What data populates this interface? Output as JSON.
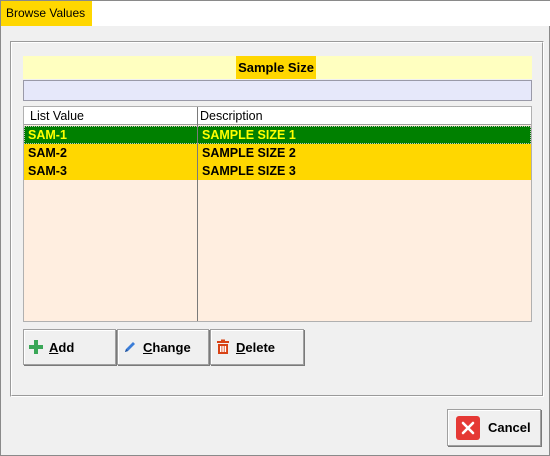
{
  "window": {
    "title": "Browse Values"
  },
  "header": {
    "title": "Sample Size"
  },
  "filter": {
    "value": ""
  },
  "table": {
    "columns": [
      "List Value",
      "Description"
    ],
    "rows": [
      {
        "value": "SAM-1",
        "description": "SAMPLE SIZE 1",
        "selected": true
      },
      {
        "value": "SAM-2",
        "description": "SAMPLE SIZE 2",
        "selected": false
      },
      {
        "value": "SAM-3",
        "description": "SAMPLE SIZE 3",
        "selected": false
      }
    ]
  },
  "actions": {
    "add": {
      "first": "A",
      "rest": "dd",
      "icon": "plus-icon"
    },
    "change": {
      "first": "C",
      "rest": "hange",
      "icon": "pencil-icon"
    },
    "delete": {
      "first": "D",
      "rest": "elete",
      "icon": "trash-icon"
    }
  },
  "footer": {
    "cancel_label": "Cancel",
    "cancel_icon": "close-icon"
  },
  "colors": {
    "accent": "#ffd700",
    "selected_row": "#008000",
    "selected_text": "#ffff00",
    "header_band": "#ffffc0",
    "grid_bg": "#ffeee0",
    "filter_bg": "#e6e8fa"
  }
}
